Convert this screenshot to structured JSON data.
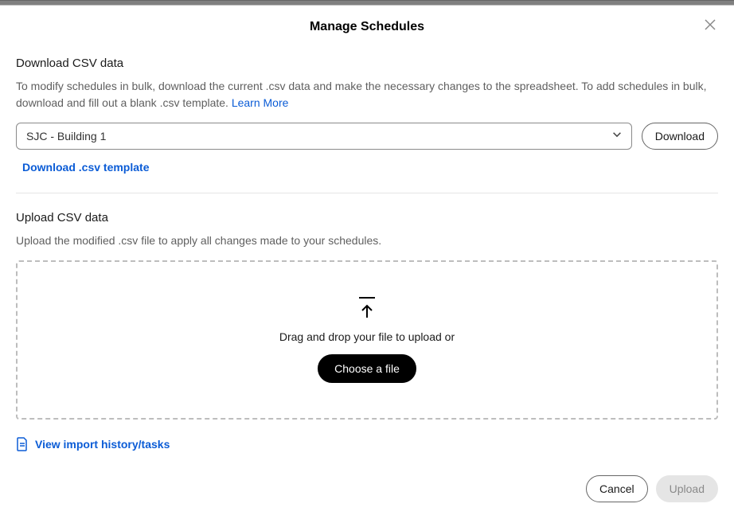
{
  "modal": {
    "title": "Manage Schedules"
  },
  "download": {
    "heading": "Download CSV data",
    "description": "To modify schedules in bulk, download the current .csv data and make the necessary changes to the spreadsheet. To add schedules in bulk, download and fill out a blank .csv template. ",
    "learn_more": "Learn More",
    "select_value": "SJC - Building 1",
    "download_label": "Download",
    "template_link": "Download .csv template"
  },
  "upload": {
    "heading": "Upload CSV data",
    "description": "Upload the modified .csv file to apply all changes made to your schedules.",
    "drop_text": "Drag and drop your file to upload or",
    "choose_file_label": "Choose a file"
  },
  "history": {
    "link_label": "View import history/tasks"
  },
  "footer": {
    "cancel_label": "Cancel",
    "upload_label": "Upload"
  }
}
